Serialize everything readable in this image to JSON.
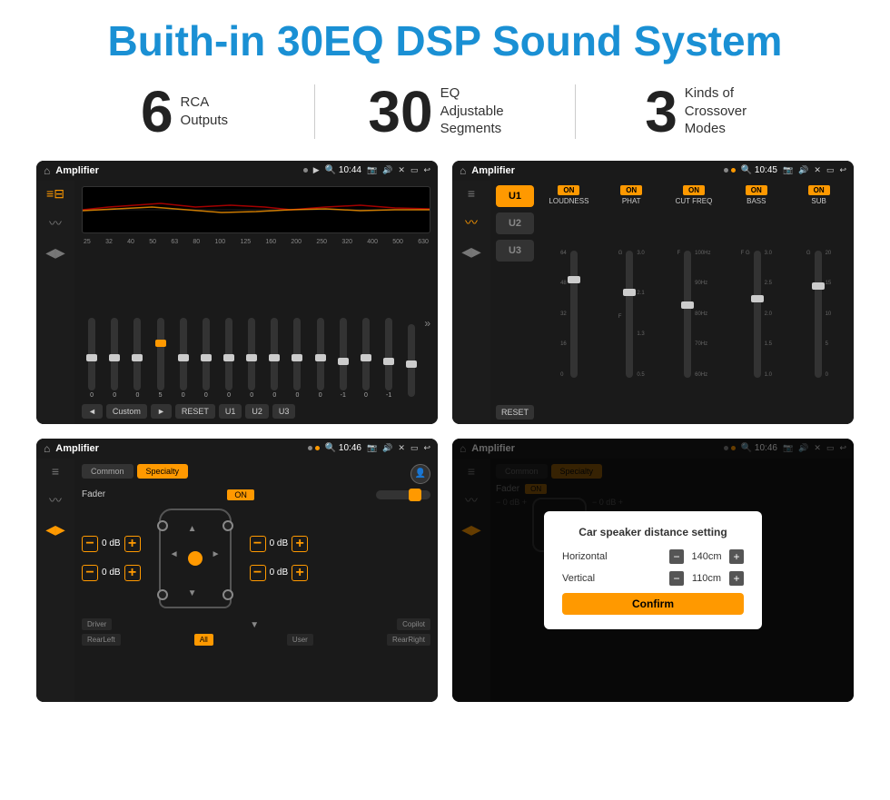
{
  "title": "Buith-in 30EQ DSP Sound System",
  "stats": [
    {
      "number": "6",
      "label": "RCA\nOutputs"
    },
    {
      "number": "30",
      "label": "EQ Adjustable\nSegments"
    },
    {
      "number": "3",
      "label": "Kinds of\nCrossover Modes"
    }
  ],
  "screens": [
    {
      "id": "screen-eq",
      "status_bar": {
        "app": "Amplifier",
        "time": "10:44"
      },
      "type": "eq"
    },
    {
      "id": "screen-crossover",
      "status_bar": {
        "app": "Amplifier",
        "time": "10:45"
      },
      "type": "crossover"
    },
    {
      "id": "screen-fader",
      "status_bar": {
        "app": "Amplifier",
        "time": "10:46"
      },
      "type": "fader"
    },
    {
      "id": "screen-distance",
      "status_bar": {
        "app": "Amplifier",
        "time": "10:46"
      },
      "type": "distance"
    }
  ],
  "eq": {
    "freqs": [
      "25",
      "32",
      "40",
      "50",
      "63",
      "80",
      "100",
      "125",
      "160",
      "200",
      "250",
      "320",
      "400",
      "500",
      "630"
    ],
    "values": [
      "0",
      "0",
      "0",
      "5",
      "0",
      "0",
      "0",
      "0",
      "0",
      "0",
      "0",
      "-1",
      "0",
      "-1",
      ""
    ],
    "profile": "Custom",
    "buttons": [
      "◄",
      "Custom",
      "►",
      "RESET",
      "U1",
      "U2",
      "U3"
    ]
  },
  "crossover": {
    "u_buttons": [
      "U1",
      "U2",
      "U3"
    ],
    "bands": [
      "LOUDNESS",
      "PHAT",
      "CUT FREQ",
      "BASS",
      "SUB"
    ],
    "on_label": "ON",
    "reset_label": "RESET"
  },
  "fader": {
    "tabs": [
      "Common",
      "Specialty"
    ],
    "fader_label": "Fader",
    "on_label": "ON",
    "bottom_buttons": [
      "Driver",
      "Copilot",
      "RearLeft",
      "All",
      "User",
      "RearRight"
    ]
  },
  "distance_dialog": {
    "title": "Car speaker distance setting",
    "horizontal_label": "Horizontal",
    "horizontal_value": "140cm",
    "vertical_label": "Vertical",
    "vertical_value": "110cm",
    "confirm_label": "Confirm"
  }
}
